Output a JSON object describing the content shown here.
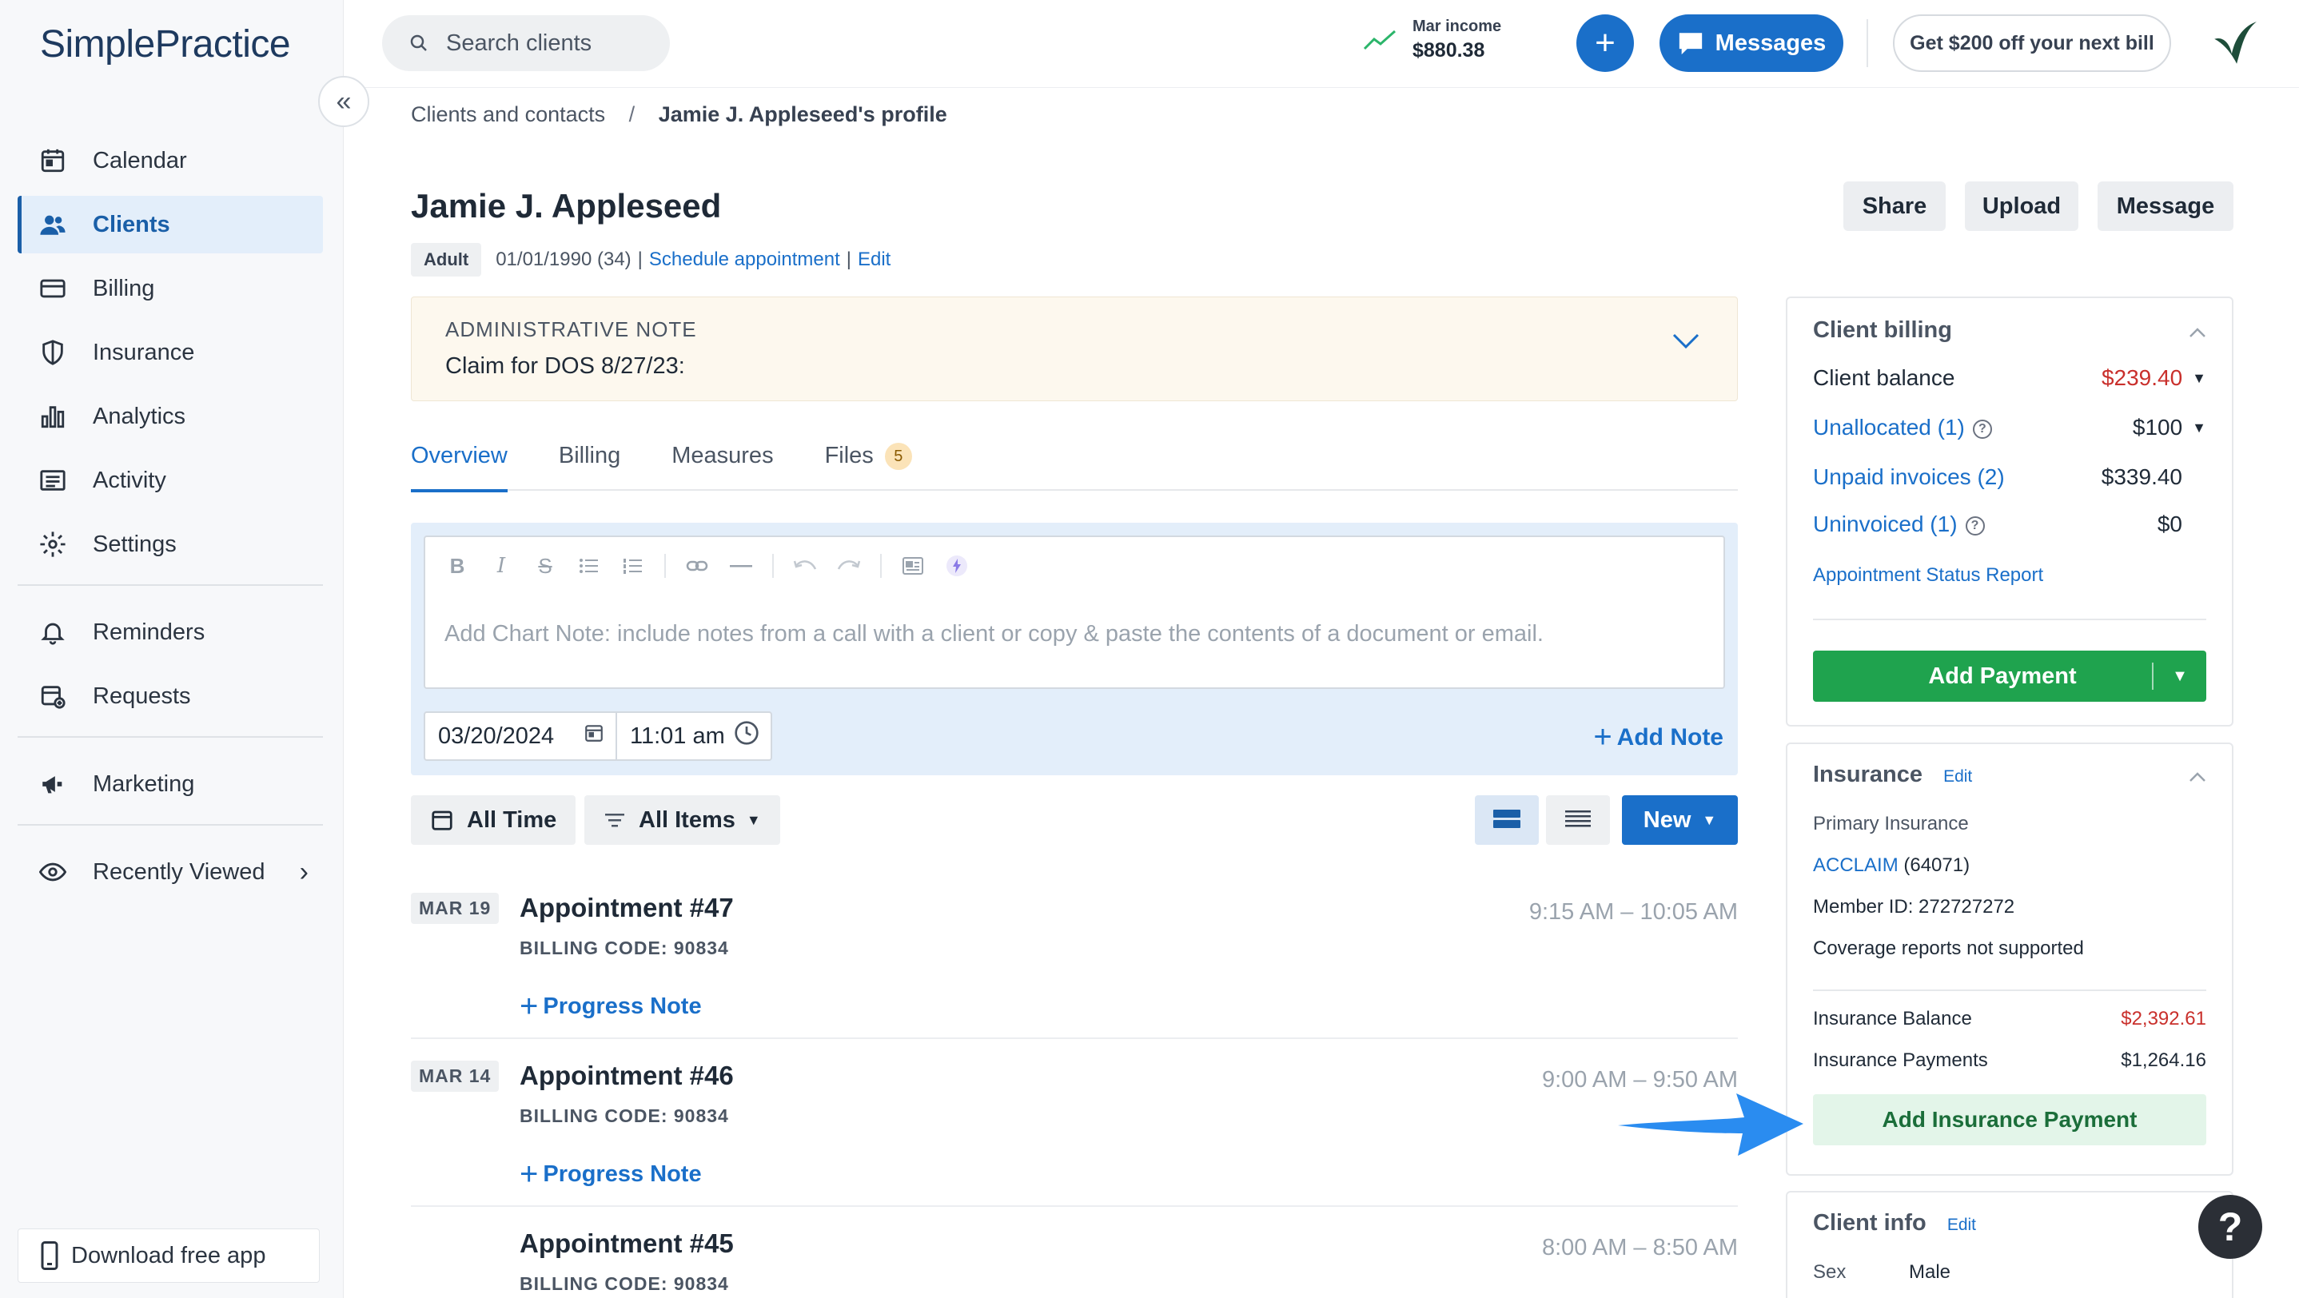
{
  "app": {
    "logo": "SimplePractice"
  },
  "sidebar": {
    "items": [
      {
        "label": "Calendar",
        "icon": "calendar-icon"
      },
      {
        "label": "Clients",
        "icon": "users-icon",
        "active": true
      },
      {
        "label": "Billing",
        "icon": "credit-card-icon"
      },
      {
        "label": "Insurance",
        "icon": "shield-icon"
      },
      {
        "label": "Analytics",
        "icon": "bar-chart-icon"
      },
      {
        "label": "Activity",
        "icon": "list-icon"
      },
      {
        "label": "Settings",
        "icon": "gear-icon"
      }
    ],
    "items2": [
      {
        "label": "Reminders",
        "icon": "bell-icon"
      },
      {
        "label": "Requests",
        "icon": "calendar-plus-icon"
      }
    ],
    "items3": [
      {
        "label": "Marketing",
        "icon": "megaphone-icon"
      }
    ],
    "recently_viewed": "Recently Viewed",
    "download_app": "Download free app"
  },
  "topbar": {
    "search_placeholder": "Search clients",
    "income_label": "Mar income",
    "income_value": "$880.38",
    "plus_label": "+",
    "messages_label": "Messages",
    "promo_label": "Get $200 off your next bill"
  },
  "breadcrumb": {
    "parent": "Clients and contacts",
    "separator": "/",
    "current": "Jamie J. Appleseed's profile"
  },
  "client": {
    "name": "Jamie J. Appleseed",
    "badge": "Adult",
    "dob": "01/01/1990 (34)",
    "schedule_link": "Schedule appointment",
    "edit_link": "Edit"
  },
  "header_buttons": {
    "share": "Share",
    "upload": "Upload",
    "message": "Message"
  },
  "admin_note": {
    "title": "ADMINISTRATIVE NOTE",
    "text": "Claim for DOS 8/27/23:"
  },
  "tabs": [
    {
      "label": "Overview",
      "active": true
    },
    {
      "label": "Billing"
    },
    {
      "label": "Measures"
    },
    {
      "label": "Files",
      "count": "5"
    }
  ],
  "chart_note": {
    "placeholder": "Add Chart Note: include notes from a call with a client or copy & paste the contents of a document or email.",
    "date": "03/20/2024",
    "time": "11:01 am",
    "add_note": "Add Note"
  },
  "filters": {
    "time": "All Time",
    "items": "All Items",
    "new": "New"
  },
  "appointments": [
    {
      "date": "MAR 19",
      "title": "Appointment #47",
      "code": "BILLING CODE: 90834",
      "time": "9:15 AM – 10:05 AM",
      "action": "Progress Note"
    },
    {
      "date": "MAR 14",
      "title": "Appointment #46",
      "code": "BILLING CODE: 90834",
      "time": "9:00 AM – 9:50 AM",
      "action": "Progress Note"
    },
    {
      "date": "",
      "title": "Appointment #45",
      "code": "BILLING CODE: 90834",
      "time": "8:00 AM – 8:50 AM",
      "action": ""
    }
  ],
  "client_billing": {
    "title": "Client billing",
    "balance_label": "Client balance",
    "balance_value": "$239.40",
    "unallocated_label": "Unallocated (1)",
    "unallocated_value": "$100",
    "unpaid_label": "Unpaid invoices (2)",
    "unpaid_value": "$339.40",
    "uninvoiced_label": "Uninvoiced (1)",
    "uninvoiced_value": "$0",
    "report_link": "Appointment Status Report",
    "add_payment": "Add Payment"
  },
  "insurance": {
    "title": "Insurance",
    "edit": "Edit",
    "primary_label": "Primary Insurance",
    "payer_link": "ACCLAIM",
    "payer_id": "(64071)",
    "member_id": "Member ID: 272727272",
    "coverage": "Coverage reports not supported",
    "balance_label": "Insurance Balance",
    "balance_value": "$2,392.61",
    "payments_label": "Insurance Payments",
    "payments_value": "$1,264.16",
    "add_payment": "Add Insurance Payment"
  },
  "client_info": {
    "title": "Client info",
    "edit": "Edit",
    "sex_label": "Sex",
    "sex_value": "Male"
  },
  "help_fab": "?",
  "colors": {
    "primary": "#1a6fc9",
    "success": "#1fa34e",
    "danger": "#c9302c",
    "note_bg": "#fdf8ee"
  }
}
